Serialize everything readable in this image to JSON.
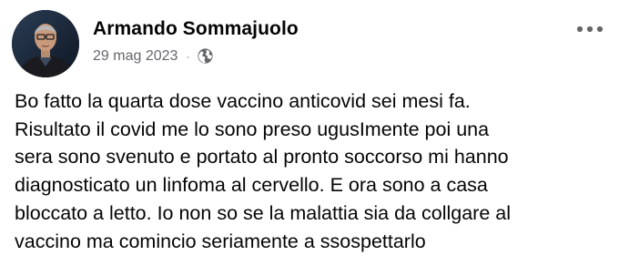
{
  "post": {
    "author": {
      "name": "Armando Sommajuolo",
      "avatar_icon": "profile-photo"
    },
    "date": "29 mag 2023",
    "separator": "·",
    "privacy_icon": "globe-icon",
    "more_icon": "more-options-icon",
    "text_lines": [
      "Bo fatto la quarta dose vaccino anticovid sei mesi fa.",
      "Risultato il covid me lo sono preso ugusImente poi una",
      "sera sono svenuto e portato al pronto soccorso mi hanno",
      "diagnosticato un linfoma al cervello. E ora sono a casa",
      "bloccato a letto. Io non so se la malattia sia da collgare al",
      "vaccino ma comincio seriamente a ssospettarlo"
    ]
  },
  "colors": {
    "text_primary": "#050505",
    "text_secondary": "#65676b",
    "background": "#ffffff"
  }
}
